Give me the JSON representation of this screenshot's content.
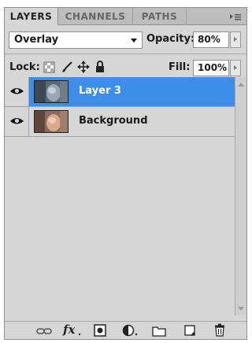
{
  "tabs": [
    {
      "label": "LAYERS",
      "active": true
    },
    {
      "label": "CHANNELS",
      "active": false
    },
    {
      "label": "PATHS",
      "active": false
    }
  ],
  "controls": {
    "blend_mode": "Overlay",
    "opacity_label": "Opacity:",
    "opacity_value": "80%",
    "lock_label": "Lock:",
    "fill_label": "Fill:",
    "fill_value": "100%"
  },
  "layers": [
    {
      "name": "Layer 3",
      "selected": true,
      "visible": true
    },
    {
      "name": "Background",
      "selected": false,
      "visible": true
    }
  ],
  "colors": {
    "selection": "#3d8ee8",
    "panel": "#d6d6d6"
  },
  "bottom_icons": [
    "link-icon",
    "fx-icon",
    "add-mask-icon",
    "adjustment-layer-icon",
    "new-group-icon",
    "new-layer-icon",
    "trash-icon"
  ]
}
